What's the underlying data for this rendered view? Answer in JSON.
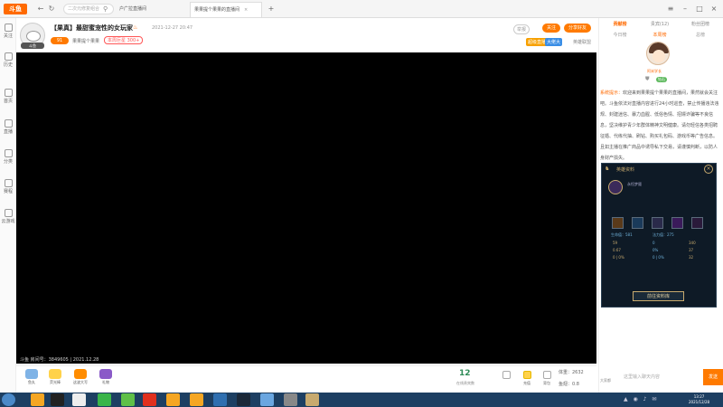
{
  "browser": {
    "logo": "斗鱼",
    "address_placeholder": "二次元修复组合",
    "tabs": [
      {
        "label": "户广拉直播间"
      },
      {
        "label": "果果提个果果的直播间"
      }
    ]
  },
  "leftrail": {
    "items": [
      "关注",
      "历史",
      "首页",
      "直播",
      "分类",
      "赛程",
      "云游戏"
    ]
  },
  "stream": {
    "title": "【果真】最甜蜜宠性的女玩家",
    "time": "2021-12-27 20:47",
    "level": "91",
    "streamer": "果果提个果果",
    "rank": "本周巨星 300+",
    "avatar_tag": "斗鱼",
    "report": "举报",
    "follow": "关注",
    "share": "分享好友",
    "tags": [
      "超级直播",
      "大佬大",
      "英雄联盟"
    ]
  },
  "video": {
    "caption": "斗鱼 房间号：3849605 | 2021.12.28"
  },
  "giftbar": {
    "gifts": [
      {
        "label": "鱼丸",
        "color": "#7fb3e6"
      },
      {
        "label": "荧光棒",
        "color": "#ffd24a"
      },
      {
        "label": "这波大写",
        "color": "#ff8c00"
      },
      {
        "label": "礼物",
        "color": "#8a5ac8"
      }
    ],
    "online": "12",
    "online_label": "在线贵宾数",
    "icons": [
      "",
      "充值",
      "背包"
    ],
    "weight": "体重：2632",
    "fishball": "鱼翅：0.8"
  },
  "right": {
    "tabs": [
      "贡献榜",
      "贵宾(12)",
      "粉丝团榜"
    ],
    "subtabs": [
      "今日榜",
      "本周榜",
      "总榜"
    ],
    "user_name": "阿米学长",
    "user_level": "钻石",
    "sys_label": "系统提示：",
    "sys_message": "欢迎来到果果提个果果的直播间，果然就会关注吧。斗鱼依法对直播内容进行24小时巡查，禁止传播违法违规、封建迷信、暴力血腥、低俗色情、招嫖诈骗等不良信息，坚决维护青少年群体精神文明健康。请勿轻信各类招聘征婚、代练代抽、刷钻、购买礼包码、游戏币等广告信息。且如主播在推广商品中诱导私下交易，请谨慎判断，以防人身财产损失。"
  },
  "overlay": {
    "title": "英雄资料",
    "champ": "永恒梦魇",
    "hp": "生命值：581",
    "mana": "法力值：275",
    "stats_left": [
      "59",
      "0.67",
      "0 | 0%"
    ],
    "stats_mid": [
      "0",
      "0%",
      "0 | 0%"
    ],
    "stats_right": [
      "340",
      "37",
      "32"
    ],
    "button": "前往资料库"
  },
  "chat": {
    "placeholder": "这里输入聊天内容",
    "send": "发送",
    "option": "大家都"
  },
  "taskbar": {
    "icons": [
      {
        "name": "browser-icon",
        "color": "#f5a623"
      },
      {
        "name": "qq-icon",
        "color": "#222"
      },
      {
        "name": "wechat-icon",
        "color": "#3ab54a"
      },
      {
        "name": "game-icon",
        "color": "#d0021b"
      },
      {
        "name": "netease-icon",
        "color": "#e0301e"
      },
      {
        "name": "douyu-icon",
        "color": "#f5a623"
      },
      {
        "name": "douyu2-icon",
        "color": "#f5a623"
      },
      {
        "name": "clock-icon",
        "color": "#2f6fb0"
      },
      {
        "name": "steam-icon",
        "color": "#1b2838"
      },
      {
        "name": "network-icon",
        "color": "#6aa6e0"
      },
      {
        "name": "tool-icon",
        "color": "#888"
      },
      {
        "name": "lol-icon",
        "color": "#c8aa6e"
      }
    ],
    "time": "13:27",
    "date": "2021/12/28"
  }
}
